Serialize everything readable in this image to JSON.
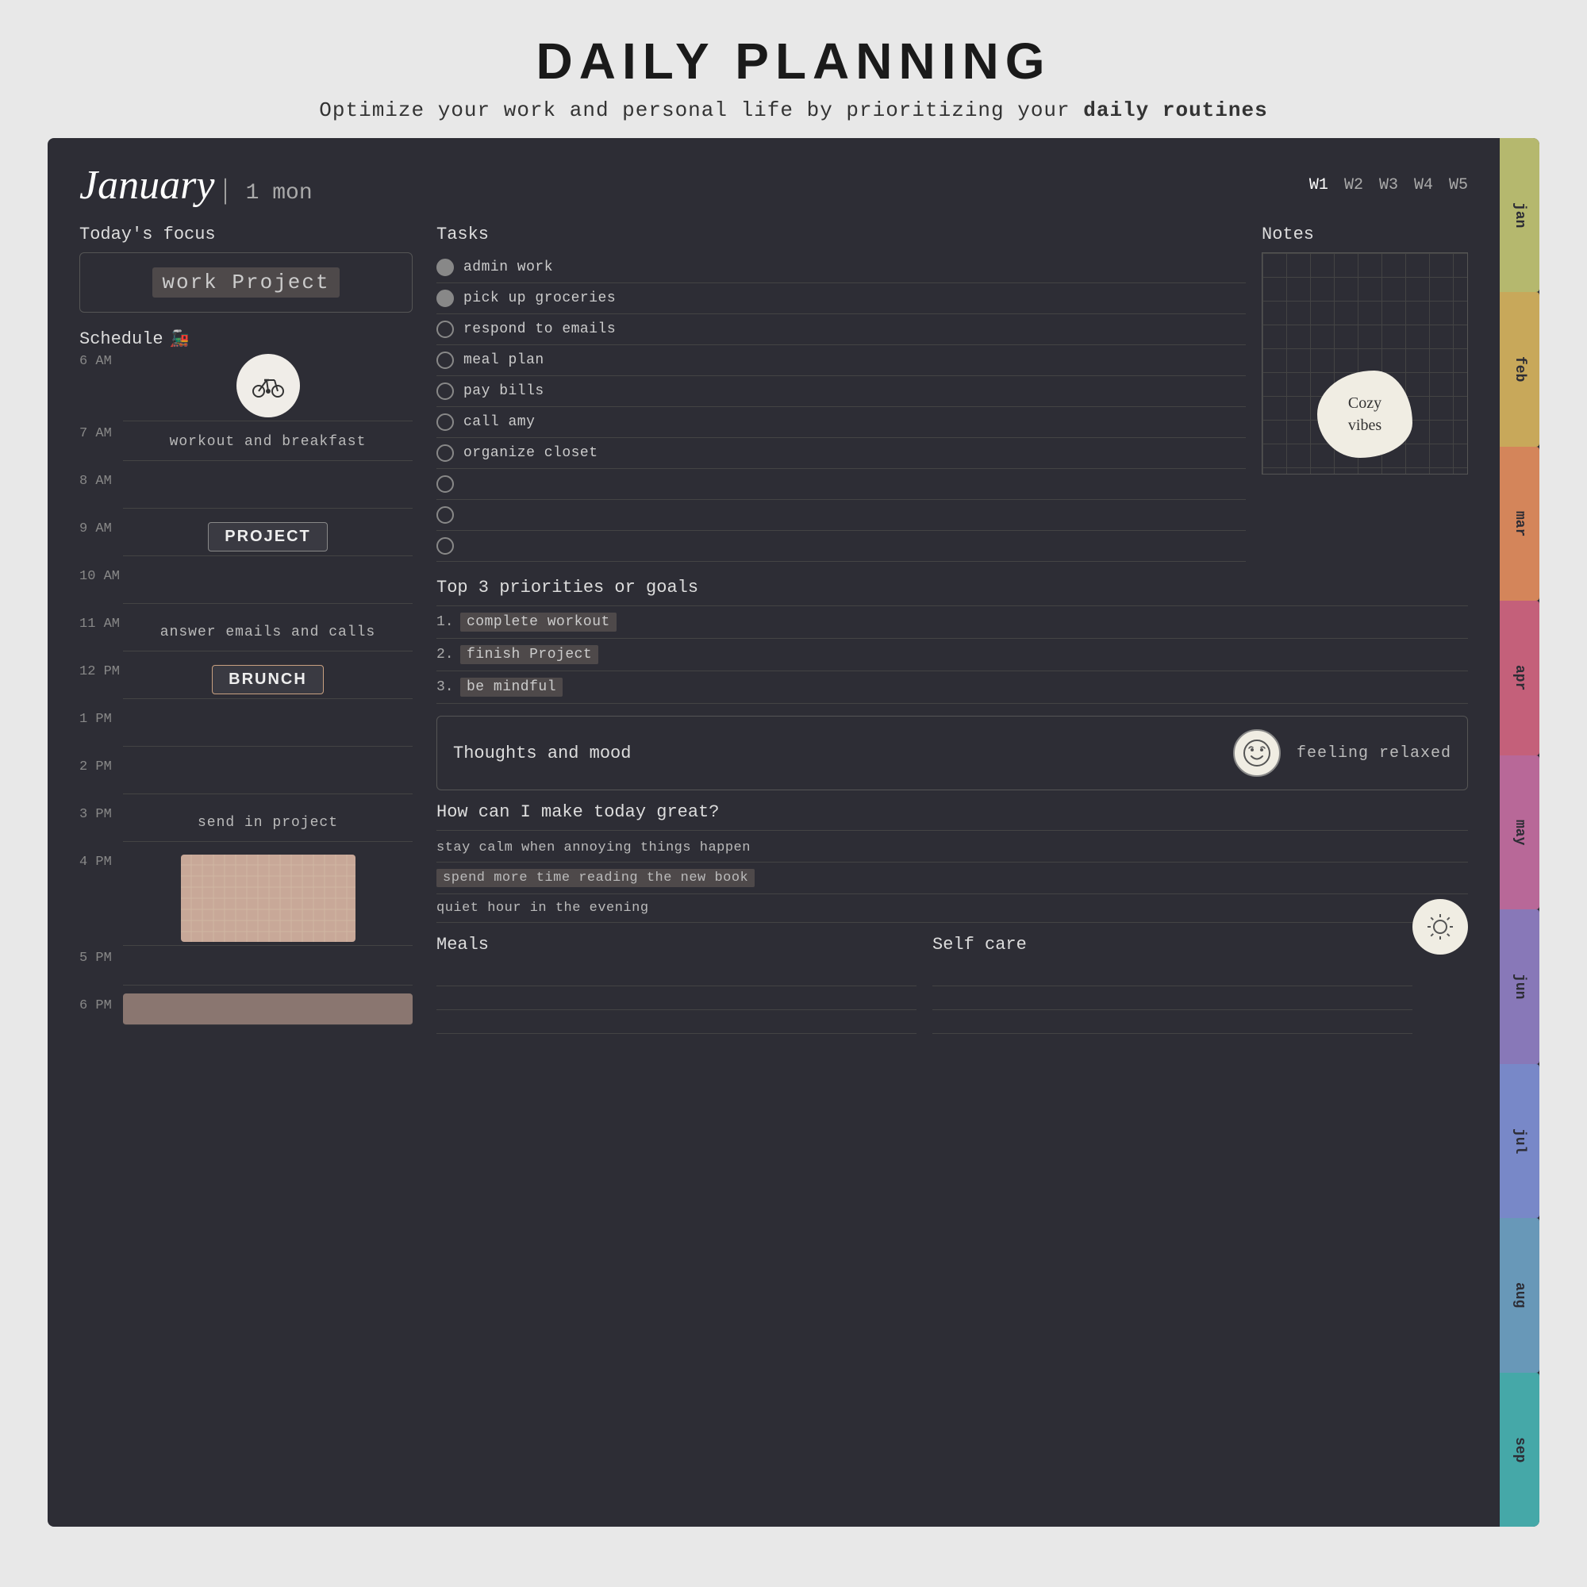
{
  "header": {
    "title": "DAILY PLANNING",
    "subtitle": "Optimize your work and personal life by prioritizing your ",
    "subtitle_bold": "daily routines"
  },
  "planner": {
    "month": "January",
    "day": "1 mon",
    "weeks": [
      "W1",
      "W2",
      "W3",
      "W4",
      "W5"
    ],
    "today_focus_label": "Today's focus",
    "today_focus_value": "work Project",
    "schedule_label": "Schedule",
    "schedule_icon": "🚂",
    "times": [
      {
        "time": "6 AM",
        "content": "bike",
        "type": "icon"
      },
      {
        "time": "7 AM",
        "content": "workout and breakfast",
        "type": "text"
      },
      {
        "time": "8 AM",
        "content": "",
        "type": "empty"
      },
      {
        "time": "9 AM",
        "content": "PROJECT",
        "type": "box"
      },
      {
        "time": "10 AM",
        "content": "",
        "type": "empty"
      },
      {
        "time": "11 AM",
        "content": "answer emails and calls",
        "type": "text"
      },
      {
        "time": "12 PM",
        "content": "BRUNCH",
        "type": "box"
      },
      {
        "time": "1 PM",
        "content": "",
        "type": "empty"
      },
      {
        "time": "2 PM",
        "content": "",
        "type": "empty"
      },
      {
        "time": "3 PM",
        "content": "send in project",
        "type": "text"
      },
      {
        "time": "4 PM",
        "content": "plaid",
        "type": "plaid"
      },
      {
        "time": "5 PM",
        "content": "",
        "type": "empty"
      },
      {
        "time": "6 PM",
        "content": "plaid2",
        "type": "plaid2"
      }
    ],
    "tasks_label": "Tasks",
    "tasks": [
      {
        "text": "admin work",
        "checked": true
      },
      {
        "text": "pick up groceries",
        "checked": true
      },
      {
        "text": "respond to emails",
        "checked": false
      },
      {
        "text": "meal plan",
        "checked": false
      },
      {
        "text": "pay bills",
        "checked": false
      },
      {
        "text": "call amy",
        "checked": false
      },
      {
        "text": "organize closet",
        "checked": false
      },
      {
        "text": "",
        "checked": false
      },
      {
        "text": "",
        "checked": false
      },
      {
        "text": "",
        "checked": false
      }
    ],
    "notes_label": "Notes",
    "cozy_vibes": "Cozy\nvibes",
    "priorities_label": "Top 3 priorities or goals",
    "priorities": [
      {
        "num": "1.",
        "text": "complete workout"
      },
      {
        "num": "2.",
        "text": "finish Project"
      },
      {
        "num": "3.",
        "text": "be mindful"
      }
    ],
    "thoughts_label": "Thoughts and mood",
    "mood_emoji": "☺",
    "mood_text": "feeling relaxed",
    "great_label": "How can I make today great?",
    "great_items": [
      {
        "text": "stay calm when annoying things happen",
        "highlighted": false
      },
      {
        "text": "spend more time reading the new book",
        "highlighted": true
      },
      {
        "text": "quiet hour in the evening",
        "highlighted": false
      }
    ],
    "meals_label": "Meals",
    "selfcare_label": "Self care",
    "months": [
      {
        "label": "jan",
        "color": "#b5b86e"
      },
      {
        "label": "feb",
        "color": "#c8a85a"
      },
      {
        "label": "mar",
        "color": "#d4855a"
      },
      {
        "label": "apr",
        "color": "#c4607a"
      },
      {
        "label": "may",
        "color": "#b86898"
      },
      {
        "label": "jun",
        "color": "#8878b8"
      },
      {
        "label": "jul",
        "color": "#7888c8"
      },
      {
        "label": "aug",
        "color": "#6898b8"
      },
      {
        "label": "sep",
        "color": "#45a8a8"
      }
    ]
  }
}
